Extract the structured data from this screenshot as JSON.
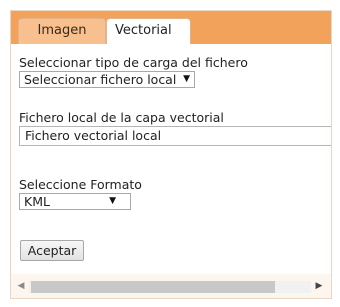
{
  "tabs": [
    {
      "label": "Imagen",
      "active": false
    },
    {
      "label": "Vectorial",
      "active": true
    }
  ],
  "load_type": {
    "label": "Seleccionar tipo de carga del fichero",
    "selected": "Seleccionar fichero local"
  },
  "local_file": {
    "label": "Fichero local de la capa vectorial",
    "value": "Fichero vectorial local"
  },
  "format": {
    "label": "Seleccione Formato",
    "selected": "KML"
  },
  "accept_label": "Aceptar",
  "scrollbar": {
    "left_glyph": "◀",
    "right_glyph": "▶"
  },
  "colors": {
    "tab_bar": "#f3a25c",
    "panel_bg": "#fdf6ee"
  }
}
